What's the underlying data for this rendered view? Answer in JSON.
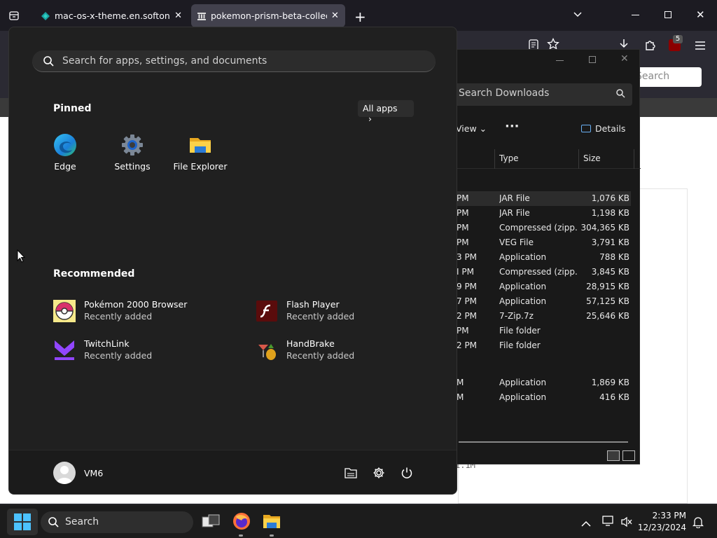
{
  "browser": {
    "tabs": [
      {
        "title": "mac-os-x-theme.en.softonic.com"
      },
      {
        "title": "pokemon-prism-beta-collection"
      }
    ],
    "extension_badge": "5",
    "page_search_placeholder": "Search",
    "page_text_fragment": "1.1M"
  },
  "explorer": {
    "search_placeholder": "Search Downloads",
    "view_label": "View",
    "details_label": "Details",
    "columns": {
      "type": "Type",
      "size": "Size"
    },
    "rows": [
      {
        "date": "PM",
        "type": "JAR File",
        "size": "1,076 KB",
        "selected": true
      },
      {
        "date": "PM",
        "type": "JAR File",
        "size": "1,198 KB"
      },
      {
        "date": "PM",
        "type": "Compressed (zipp...",
        "size": "304,365 KB"
      },
      {
        "date": "PM",
        "type": "VEG File",
        "size": "3,791 KB"
      },
      {
        "date": "3 PM",
        "type": "Application",
        "size": "788 KB"
      },
      {
        "date": "I PM",
        "type": "Compressed (zipp...",
        "size": "3,845 KB"
      },
      {
        "date": "9 PM",
        "type": "Application",
        "size": "28,915 KB"
      },
      {
        "date": "7 PM",
        "type": "Application",
        "size": "57,125 KB"
      },
      {
        "date": "2 PM",
        "type": "7-Zip.7z",
        "size": "25,646 KB"
      },
      {
        "date": "PM",
        "type": "File folder",
        "size": ""
      },
      {
        "date": "2 PM",
        "type": "File folder",
        "size": ""
      },
      {
        "date": "M",
        "type": "Application",
        "size": "1,869 KB"
      },
      {
        "date": "M",
        "type": "Application",
        "size": "416 KB"
      }
    ]
  },
  "start_menu": {
    "search_placeholder": "Search for apps, settings, and documents",
    "pinned_title": "Pinned",
    "all_apps_label": "All apps",
    "pinned": [
      {
        "label": "Edge",
        "icon": "edge-icon"
      },
      {
        "label": "Settings",
        "icon": "settings-gear-icon"
      },
      {
        "label": "File Explorer",
        "icon": "folder-icon"
      }
    ],
    "recommended_title": "Recommended",
    "recommended": [
      {
        "name": "Pokémon 2000 Browser",
        "sub": "Recently added",
        "icon": "pokeball-icon"
      },
      {
        "name": "Flash Player",
        "sub": "Recently added",
        "icon": "flash-icon"
      },
      {
        "name": "TwitchLink",
        "sub": "Recently added",
        "icon": "twitchlink-icon"
      },
      {
        "name": "HandBrake",
        "sub": "Recently added",
        "icon": "handbrake-icon"
      }
    ],
    "user_name": "VM6"
  },
  "taskbar": {
    "search_label": "Search",
    "time": "2:33 PM",
    "date": "12/23/2024"
  }
}
